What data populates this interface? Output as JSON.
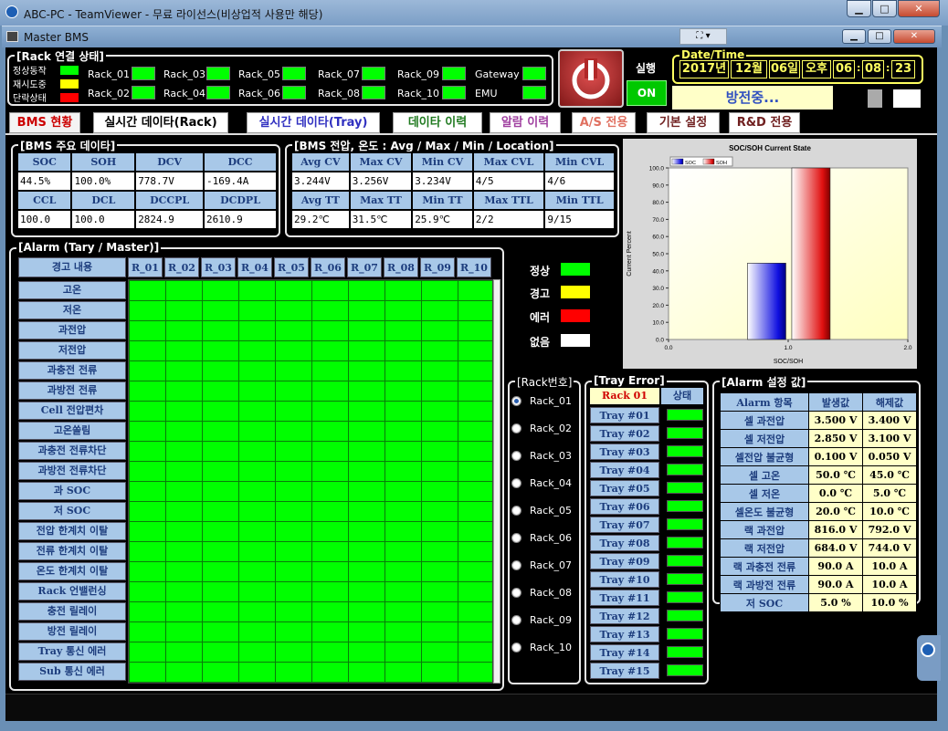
{
  "window": {
    "title": "ABC-PC - TeamViewer - 무료 라이선스(비상업적 사용만 해당)",
    "inner_title": "Master BMS",
    "min": "▁",
    "max": "□",
    "close": "✕"
  },
  "rack_conn": {
    "title": "[Rack 연결 상태]",
    "legend": [
      "정상동작",
      "재시도중",
      "단락상태"
    ],
    "legend_colors": [
      "#00ff00",
      "#ffff00",
      "#ff0000"
    ],
    "racks": [
      "Rack_01",
      "Rack_02",
      "Rack_03",
      "Rack_04",
      "Rack_05",
      "Rack_06",
      "Rack_07",
      "Rack_08",
      "Rack_09",
      "Rack_10"
    ],
    "gateway": "Gateway",
    "emu": "EMU"
  },
  "run": {
    "label": "실행",
    "state": "ON"
  },
  "datetime": {
    "title": "Date/Time",
    "year": "2017년",
    "month": "12월",
    "day": "06일",
    "ampm": "오후",
    "h": "06",
    "m": "08",
    "s": "23",
    "sep": ":"
  },
  "status_msg": "방전중...",
  "tabs": [
    "BMS 현황",
    "실시간 데이타(Rack)",
    "실시간 데이타(Tray)",
    "데이타 이력",
    "알람 이력",
    "A/S 전용",
    "기본 설정",
    "R&D 전용"
  ],
  "tab_colors": [
    "#cc0000",
    "#000000",
    "#3030c0",
    "#207a20",
    "#a040a0",
    "#e07060",
    "#702020",
    "#702020"
  ],
  "bms_main": {
    "title": "[BMS 주요 데이타]",
    "h1": [
      "SOC",
      "SOH",
      "DCV",
      "DCC"
    ],
    "v1": [
      "44.5%",
      "100.0%",
      "778.7V",
      "-169.4A"
    ],
    "h2": [
      "CCL",
      "DCL",
      "DCCPL",
      "DCDPL"
    ],
    "v2": [
      "100.0",
      "100.0",
      "2824.9",
      "2610.9"
    ]
  },
  "bms_vt": {
    "title": "[BMS 전압, 온도 : Avg / Max / Min / Location]",
    "h1": [
      "Avg CV",
      "Max CV",
      "Min CV",
      "Max CVL",
      "Min CVL"
    ],
    "v1": [
      "3.244V",
      "3.256V",
      "3.234V",
      "4/5",
      "4/6"
    ],
    "h2": [
      "Avg TT",
      "Max TT",
      "Min TT",
      "Max TTL",
      "Min TTL"
    ],
    "v2": [
      "29.2℃",
      "31.5℃",
      "25.9℃",
      "2/2",
      "9/15"
    ]
  },
  "chart_data": {
    "type": "bar",
    "title": "SOC/SOH Current State",
    "xlabel": "SOC/SOH",
    "ylabel": "Current Percent",
    "ylim": [
      0,
      100
    ],
    "xlim": [
      0,
      2
    ],
    "yticks": [
      "100.0",
      "90.0",
      "80.0",
      "70.0",
      "60.0",
      "50.0",
      "40.0",
      "30.0",
      "20.0",
      "10.0",
      "0.0"
    ],
    "xticks": [
      "0.0",
      "1.0",
      "2.0"
    ],
    "series": [
      {
        "name": "SOC",
        "values": [
          44.5
        ],
        "color": "#2020e0"
      },
      {
        "name": "SOH",
        "values": [
          100.0
        ],
        "color": "#e02020"
      }
    ],
    "legend_placement": "top-left"
  },
  "alarm": {
    "title": "[Alarm (Tary / Master)]",
    "header": "경고 내용",
    "cols": [
      "R_01",
      "R_02",
      "R_03",
      "R_04",
      "R_05",
      "R_06",
      "R_07",
      "R_08",
      "R_09",
      "R_10"
    ],
    "rows": [
      "고온",
      "저온",
      "과전압",
      "저전압",
      "과충전 전류",
      "과방전 전류",
      "Cell 전압편차",
      "고온쏠림",
      "과충전 전류차단",
      "과방전 전류차단",
      "과 SOC",
      "저 SOC",
      "전압 한계치 이탈",
      "전류 한계치 이탈",
      "온도 한계치 이탈",
      "Rack 언밸런싱",
      "충전 릴레이",
      "방전 릴레이",
      "Tray 통신 에러",
      "Sub 통신 에러"
    ]
  },
  "state_legend": [
    {
      "label": "정상",
      "color": "#00ff00"
    },
    {
      "label": "경고",
      "color": "#ffff00"
    },
    {
      "label": "에러",
      "color": "#ff0000"
    },
    {
      "label": "없음",
      "color": "#ffffff"
    }
  ],
  "rack_select": {
    "title": "[Rack번호]",
    "items": [
      "Rack_01",
      "Rack_02",
      "Rack_03",
      "Rack_04",
      "Rack_05",
      "Rack_06",
      "Rack_07",
      "Rack_08",
      "Rack_09",
      "Rack_10"
    ],
    "selected": "Rack_01"
  },
  "tray_error": {
    "title": "[Tray Error]",
    "rack": "Rack 01",
    "state": "상태",
    "trays": [
      "Tray #01",
      "Tray #02",
      "Tray #03",
      "Tray #04",
      "Tray #05",
      "Tray #06",
      "Tray #07",
      "Tray #08",
      "Tray #09",
      "Tray #10",
      "Tray #11",
      "Tray #12",
      "Tray #13",
      "Tray #14",
      "Tray #15"
    ]
  },
  "alarm_set": {
    "title": "[Alarm 설정 값]",
    "headers": [
      "Alarm 항목",
      "발생값",
      "해제값"
    ],
    "rows": [
      [
        "셀 과전압",
        "3.500 V",
        "3.400 V"
      ],
      [
        "셀 저전압",
        "2.850 V",
        "3.100 V"
      ],
      [
        "셀전압 불균형",
        "0.100 V",
        "0.050 V"
      ],
      [
        "셀 고온",
        "50.0 ℃",
        "45.0 ℃"
      ],
      [
        "셀 저온",
        "0.0 ℃",
        "5.0 ℃"
      ],
      [
        "셀온도 불균형",
        "20.0 ℃",
        "10.0 ℃"
      ],
      [
        "랙 과전압",
        "816.0 V",
        "792.0 V"
      ],
      [
        "랙 저전압",
        "684.0 V",
        "744.0 V"
      ],
      [
        "랙 과충전 전류",
        "90.0 A",
        "10.0 A"
      ],
      [
        "랙 과방전 전류",
        "90.0 A",
        "10.0 A"
      ],
      [
        "저 SOC",
        "5.0 %",
        "10.0 %"
      ]
    ]
  }
}
